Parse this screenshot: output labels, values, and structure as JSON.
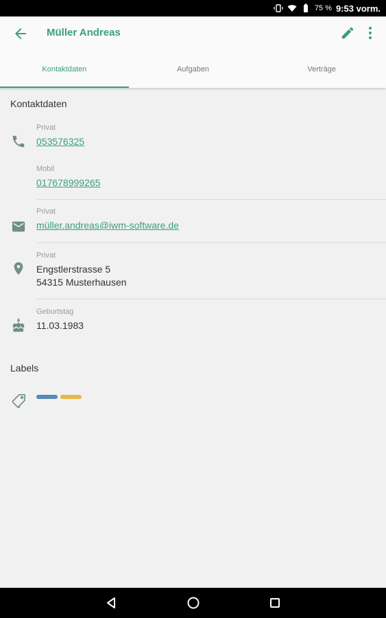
{
  "status_bar": {
    "battery": "75 %",
    "time": "9:53 vorm."
  },
  "app_bar": {
    "title": "Müller Andreas"
  },
  "tabs": [
    {
      "label": "Kontaktdaten",
      "active": true
    },
    {
      "label": "Aufgaben",
      "active": false
    },
    {
      "label": "Verträge",
      "active": false
    }
  ],
  "contact": {
    "section_title": "Kontaktdaten",
    "phone_private": {
      "label": "Privat",
      "value": "053576325"
    },
    "phone_mobile": {
      "label": "Mobil",
      "value": "017678999265"
    },
    "email": {
      "label": "Privat",
      "value": "müller.andreas@iwm-software.de"
    },
    "address": {
      "label": "Privat",
      "line1": "Engstlerstrasse 5",
      "line2": "54315 Musterhausen"
    },
    "birthday": {
      "label": "Geburtstag",
      "value": "11.03.1983"
    }
  },
  "labels": {
    "section_title": "Labels",
    "chips": [
      {
        "color": "#5b88b3"
      },
      {
        "color": "#e7b84a"
      }
    ]
  },
  "colors": {
    "accent": "#3a9d83"
  },
  "icons": {
    "phone": "phone-icon",
    "email": "email-icon",
    "location": "location-icon",
    "birthday": "cake-icon",
    "labels": "label-icon"
  }
}
